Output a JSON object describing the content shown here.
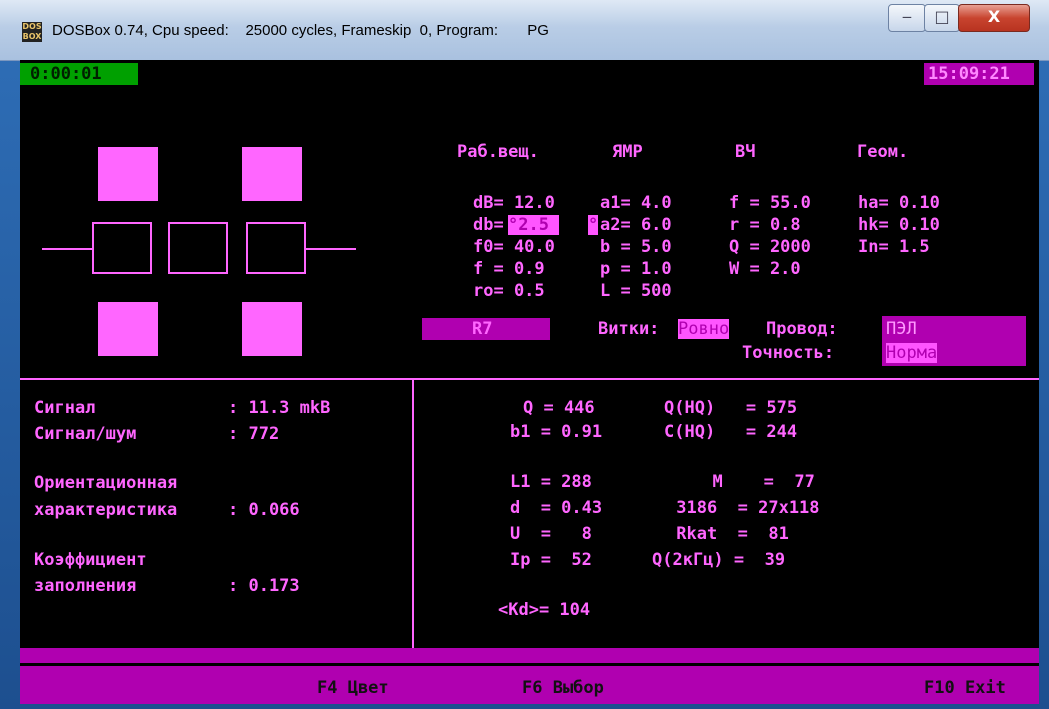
{
  "window": {
    "title": "DOSBox 0.74, Cpu speed:    25000 cycles, Frameskip  0, Program:       PG",
    "icon_text": "DOS BOX",
    "minimize_glyph": "‒",
    "maximize_glyph": "□",
    "close_glyph": "X"
  },
  "status": {
    "timer": "0:00:01",
    "clock": "15:09:21"
  },
  "headers": [
    "Раб.вещ.",
    "ЯМР",
    "ВЧ",
    "Геом."
  ],
  "params": {
    "col1": [
      "dB= 12.0",
      "db=",
      "f0= 40.0",
      "f = 0.9",
      "ro= 0.5"
    ],
    "db_value": "°2.5 ",
    "col2": [
      "a1= 4.0",
      "a2= 6.0",
      "b = 5.0",
      "p = 1.0",
      "L = 500"
    ],
    "a2_marker": "°",
    "col3": [
      "f = 55.0",
      "r = 0.8",
      "Q = 2000",
      "W = 2.0"
    ],
    "col4": [
      "ha= 0.10",
      "hk= 0.10",
      "In= 1.5"
    ]
  },
  "selectors": {
    "r7": "R7",
    "vitki_label": "Витки:",
    "vitki_value": "Ровно",
    "provod_label": "Провод:",
    "provod_value": "ПЭЛ",
    "tochnost_label": "Точность:",
    "tochnost_value": "Норма"
  },
  "results_left": {
    "signal_label": "Сигнал",
    "signal_value": ": 11.3 mkB",
    "snr_label": "Сигнал/шум",
    "snr_value": ": 772",
    "orient_label1": "Ориентационная",
    "orient_label2": "характеристика",
    "orient_value": ": 0.066",
    "fill_label1": "Коэффициент",
    "fill_label2": "заполнения",
    "fill_value": ": 0.173"
  },
  "results_right": {
    "col1": [
      "Q = 446",
      "b1 = 0.91",
      "",
      "L1 = 288",
      "d  = 0.43",
      "U  =   8",
      "Ip =  52",
      "",
      "<Kd>= 104"
    ],
    "col2": [
      "Q(HQ)   = 575",
      "C(HQ)   = 244",
      "",
      "  M    =  77",
      " 3186  = 27x118",
      " Rkat  =  81",
      "Q(2кГц) =  39"
    ]
  },
  "footer": {
    "f4": "F4 Цвет",
    "f6": "F6 Выбор",
    "f10": "F10 Exit"
  },
  "colors": {
    "magenta": "#ff66ff",
    "dark_magenta": "#b000b0",
    "timer_bg": "#00a000"
  }
}
